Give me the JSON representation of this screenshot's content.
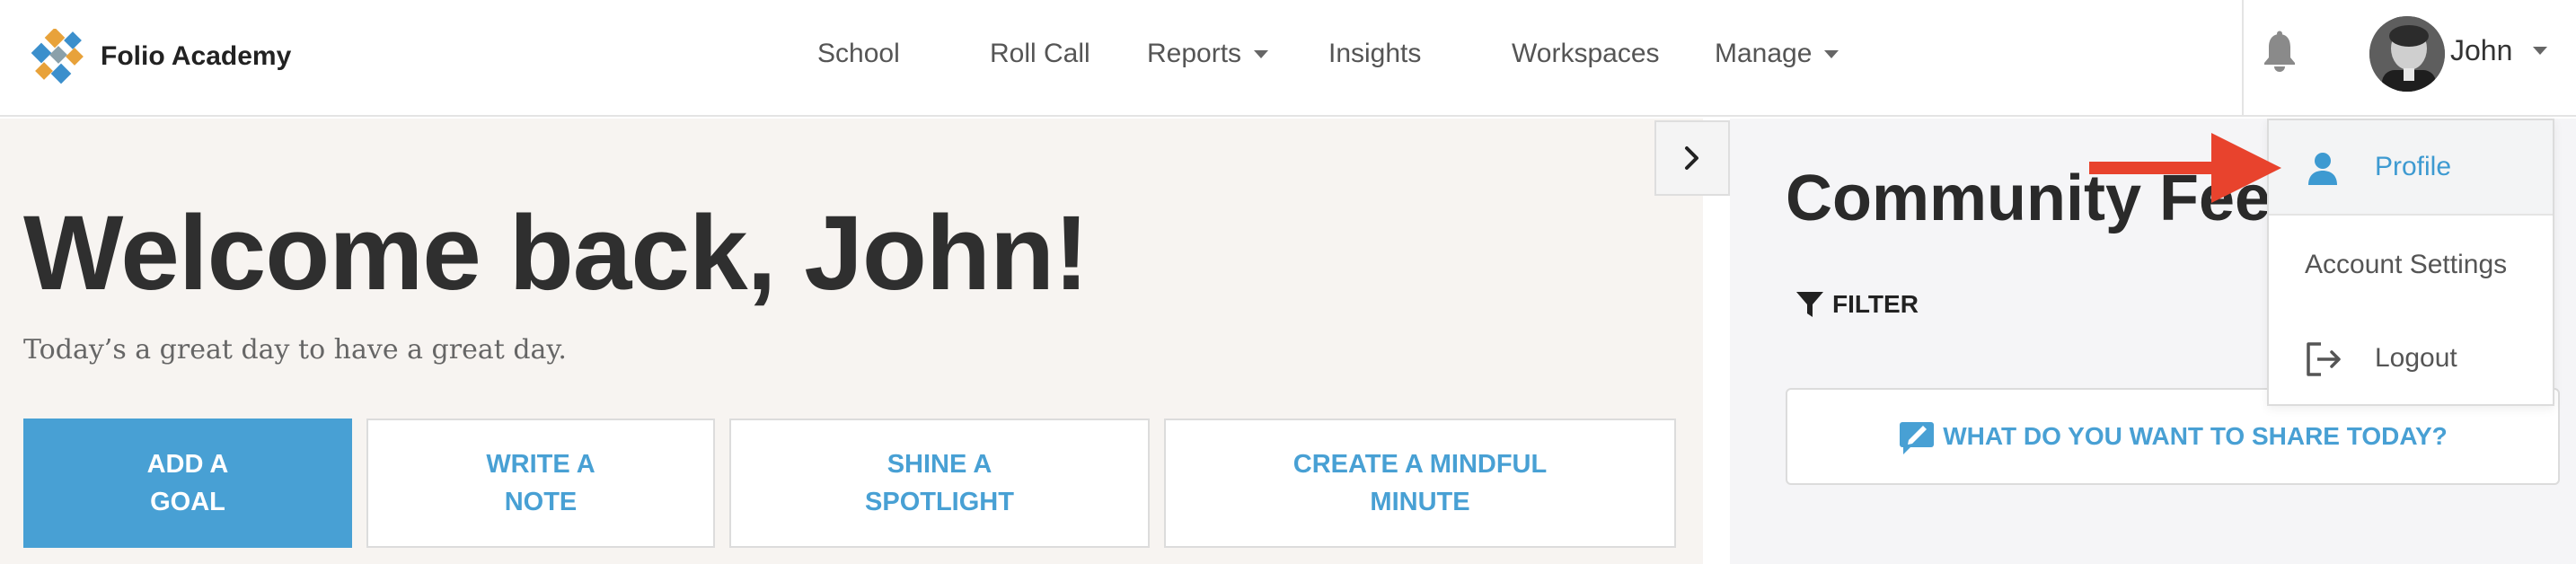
{
  "brand": {
    "name": "Folio Academy",
    "logo_icon": "folio-academy-logo"
  },
  "nav": {
    "items": [
      {
        "label": "School",
        "has_caret": false
      },
      {
        "label": "Roll Call",
        "has_caret": false
      },
      {
        "label": "Reports",
        "has_caret": true
      },
      {
        "label": "Insights",
        "has_caret": false
      },
      {
        "label": "Workspaces",
        "has_caret": false
      },
      {
        "label": "Manage",
        "has_caret": true
      }
    ]
  },
  "user": {
    "name": "John",
    "notifications_icon": "bell-icon"
  },
  "main": {
    "heading": "Welcome back, John!",
    "tagline": "Today’s a great day to have a great day.",
    "actions": [
      {
        "label": "Add a\nGoal",
        "style": "primary"
      },
      {
        "label": "Write a\nNote",
        "style": "outline"
      },
      {
        "label": "Shine a\nSpotlight",
        "style": "outline"
      },
      {
        "label": "Create a Mindful\nMinute",
        "style": "outline"
      }
    ]
  },
  "feed": {
    "title": "Community Feed",
    "filter_label": "FILTER",
    "share_prompt": "WHAT DO YOU WANT TO SHARE TODAY?"
  },
  "user_menu": {
    "items": [
      {
        "label": "Profile",
        "icon": "person-icon",
        "active": true
      },
      {
        "label": "Account Settings",
        "icon": "",
        "active": false
      },
      {
        "label": "Logout",
        "icon": "logout-icon",
        "active": false
      }
    ]
  },
  "colors": {
    "accent": "#48a0d4",
    "menu_active": "#3d9ad1",
    "pointer_arrow": "#e8432d",
    "main_background": "#f7f4f1"
  }
}
